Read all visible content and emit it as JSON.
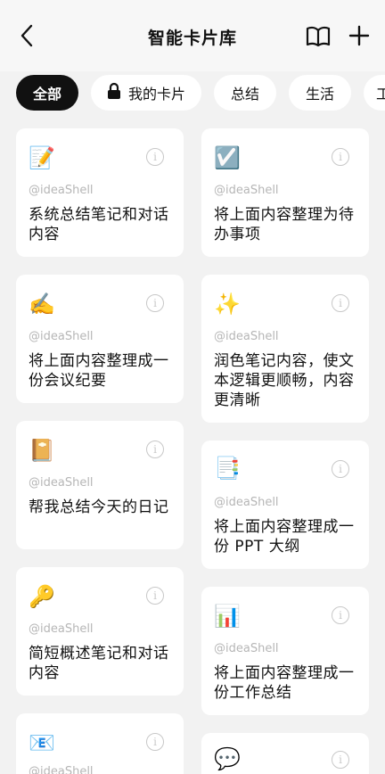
{
  "header": {
    "title": "智能卡片库",
    "back_icon": "chevron-left-icon",
    "book_icon": "book-open-icon",
    "add_icon": "plus-icon"
  },
  "tabs": [
    {
      "label": "全部",
      "active": true
    },
    {
      "label": "我的卡片",
      "icon": "lock-icon"
    },
    {
      "label": "总结"
    },
    {
      "label": "生活"
    },
    {
      "label": "工"
    }
  ],
  "cards": {
    "author": "@ideaShell",
    "info_glyph": "i",
    "left": [
      {
        "emoji": "📝",
        "text": "系统总结笔记和对话内容"
      },
      {
        "emoji": "✍️",
        "text": "将上面内容整理成一份会议纪要"
      },
      {
        "emoji": "📔",
        "text": "帮我总结今天的日记"
      },
      {
        "emoji": "🔑",
        "text": "简短概述笔记和对话内容"
      },
      {
        "emoji": "📧",
        "text": ""
      }
    ],
    "right": [
      {
        "emoji": "☑️",
        "text": "将上面内容整理为待办事项"
      },
      {
        "emoji": "✨",
        "text": "润色笔记内容，使文本逻辑更顺畅，内容更清晰"
      },
      {
        "emoji": "📑",
        "text": "将上面内容整理成一份 PPT 大纲"
      },
      {
        "emoji": "📊",
        "text": "将上面内容整理成一份工作总结"
      },
      {
        "emoji": "💬",
        "text": ""
      }
    ]
  }
}
